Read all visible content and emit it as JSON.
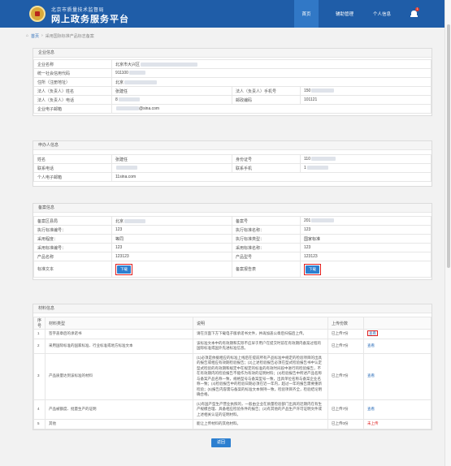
{
  "header": {
    "org": "北京市质量技术监督局",
    "title": "网上政务服务平台",
    "nav": [
      "首页",
      "辅助管理",
      "个人信息"
    ],
    "bell_badge": "1"
  },
  "breadcrumb": {
    "home": "首页",
    "current": "采用国际标准产品标志备案"
  },
  "enterprise": {
    "title": "企业信息",
    "rows": [
      {
        "label": "企业名称",
        "value": "北京市大兴区"
      },
      {
        "label": "统一社会信用代码",
        "value": "911100"
      },
      {
        "label": "住所（注册地址）",
        "value": "北京"
      }
    ],
    "legal_name_label": "法人（负责人）姓名",
    "legal_name": "张建任",
    "legal_mobile_label": "法人（负责人）手机号",
    "legal_mobile": "150",
    "legal_phone_label": "法人（负责人）电话",
    "legal_phone": "8",
    "postcode_label": "邮政编码",
    "postcode": "101121",
    "email_label": "企业电子邮箱",
    "email": "@sina.com"
  },
  "applicant": {
    "title": "申办人信息",
    "name_label": "姓名",
    "name": "张建任",
    "id_label": "身份证号",
    "id": "110",
    "phone_label": "联系电话",
    "mobile_label": "联系手机",
    "mobile": "1",
    "email_label": "个人电子邮箱",
    "email": "11sina.com"
  },
  "filing": {
    "title": "备案信息",
    "district_label": "备案区县局",
    "district": "北京",
    "no_label": "备案号",
    "no": "201",
    "exec_std_no_label": "执行标准编号：",
    "exec_std_no": "123",
    "exec_std_name_label": "执行标准名称：",
    "exec_std_name": "123",
    "std_level_label": "采用程度：",
    "std_level": "等同",
    "exec_std_type_label": "执行标准类型：",
    "exec_std_type": "国家标准",
    "adopt_std_no_label": "采用标准编号：",
    "adopt_std_no": "123",
    "adopt_std_name_label": "采用标准名称：",
    "adopt_std_name": "123",
    "product_name_label": "产品名称",
    "product_name": "123123",
    "product_model_label": "产品型号",
    "product_model": "123123",
    "std_text_label": "标准文本",
    "std_text_btn": "下载",
    "report_label": "备案报告表",
    "report_btn": "下载"
  },
  "materials": {
    "title": "材料信息",
    "headers": [
      "序号",
      "材料类型",
      "说明",
      "上传份数"
    ],
    "rows": [
      {
        "no": "1",
        "type": "签字盖章后的承诺书",
        "desc": "请在页面下方下载电子版承诺书文件，并再加盖公章后扫描后上传。",
        "uploaded": "已上传7份",
        "action": "查看",
        "highlight": true
      },
      {
        "no": "2",
        "type": "采用国际标准的国家标准、行业标准或地方标准文本",
        "desc": "该标准文本中的有效期和实际不应早于用户在提交时前在有效期内备案过程的国际标准或国外先进标准信息。",
        "uploaded": "已上传7份",
        "action": "查看"
      },
      {
        "no": "3",
        "type": "产品质量达到该标准的材料",
        "desc": "(1)必须是依据相应的标准上线后在提前所有产品标准中规定的检验项目的出具的报告或相应有效期检验报告；(2)上述检验报告必须在型式检验报告书中认定型式检验的有效期和规定中在规定的标准的有效时间段中进行的检验报告，不在有效期内的检验报告不能作为有效的证明材料；(3)检验报告中所述产品名称与备案产品名称一致，规格型号与备案型号一致，出具单位名称与备案企业名称一致；(4)检验报告中的检验日期必须在近一年内，超过一年的报告需要重新检验；(5)报告内容需与备案的标准文本保持一致，检验项目齐全，检验结论明确合格。",
        "uploaded": "已上传7份",
        "action": "查看"
      },
      {
        "no": "4",
        "type": "产品被额度、批量生产的证明",
        "desc": "(1)有国产型生产营业执照的，一般由企业在质量检验部门出具的近期内在有生产规模合理、具备相应检验条件的报告；(2)有其他的产品生产许可证明文件或上述相关认证的证明材料。",
        "uploaded": "已上传7份",
        "action": "查看"
      },
      {
        "no": "5",
        "type": "其他",
        "desc": "能让上传材料的其他材料。",
        "uploaded": "已上传0份",
        "action": "未上传",
        "missing": true
      }
    ]
  },
  "return_label": "返回"
}
